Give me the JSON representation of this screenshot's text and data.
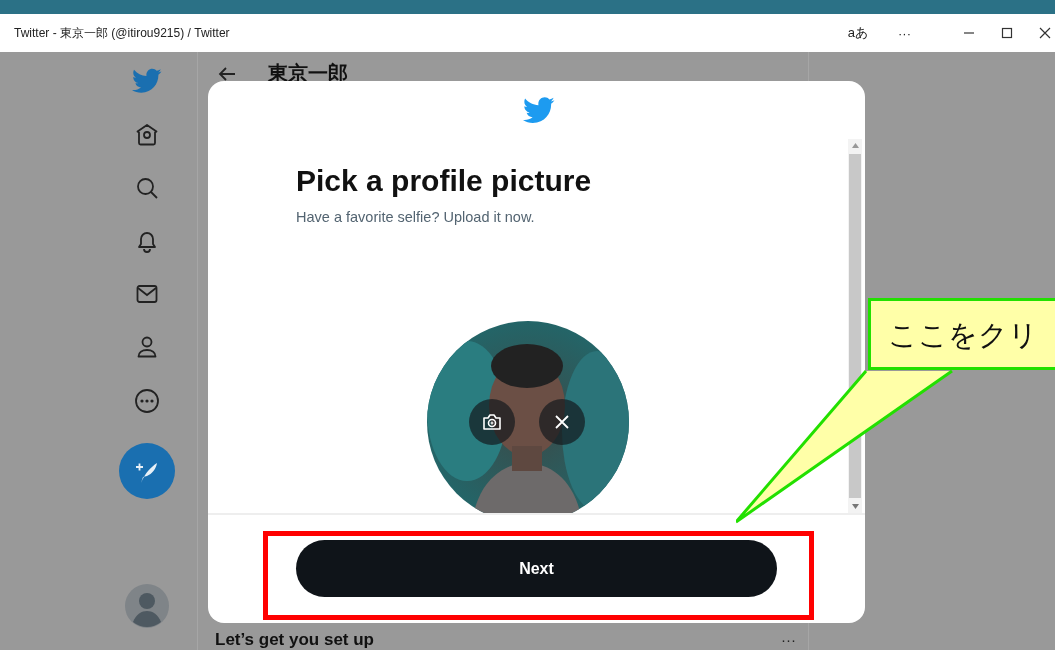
{
  "window": {
    "title": "Twitter - 東京一郎 (@itirou9215) / Twitter",
    "toolbar": [
      "aあ",
      "···"
    ]
  },
  "header": {
    "title": "東京一郎"
  },
  "background_section": {
    "title": "Let’s get you set up",
    "menu": "···"
  },
  "modal": {
    "title": "Pick a profile picture",
    "subtitle": "Have a favorite selfie? Upload it now.",
    "next_button": "Next"
  },
  "annotation": {
    "callout": "ここをクリ"
  }
}
